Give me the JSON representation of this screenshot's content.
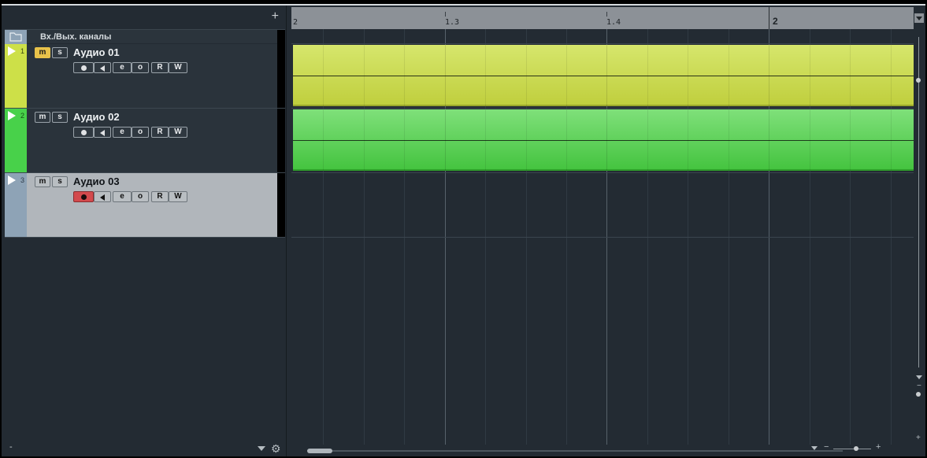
{
  "toolbar": {
    "add_track": "+"
  },
  "folder": {
    "label": "Вх./Вых. каналы"
  },
  "tracks": [
    {
      "number": "1",
      "name": "Аудио 01",
      "color": "#cde048",
      "mute": "m",
      "solo": "s",
      "mute_active": true,
      "record_active": false
    },
    {
      "number": "2",
      "name": "Аудио 02",
      "color": "#48d14a",
      "mute": "m",
      "solo": "s",
      "mute_active": false,
      "record_active": false
    },
    {
      "number": "3",
      "name": "Аудио 03",
      "color": "#8ea3b6",
      "mute": "m",
      "solo": "s",
      "mute_active": false,
      "record_active": true,
      "selected": true
    }
  ],
  "track_buttons": {
    "edit": "e",
    "monitor": "o",
    "read": "R",
    "write": "W"
  },
  "ruler": {
    "labels": [
      "2",
      "1.3",
      "1.4",
      "2"
    ]
  },
  "events": [
    {
      "track": "Аудио 01",
      "color_top": "#d6e66c",
      "color_bottom": "#c0cf3e"
    },
    {
      "track": "Аудио 02",
      "color_top": "#7fe07a",
      "color_bottom": "#45c440"
    }
  ],
  "bottom": {
    "minus": "-",
    "zoom_minus": "−",
    "zoom_plus": "+",
    "vertical_plus": "+",
    "vertical_minus": "−"
  }
}
